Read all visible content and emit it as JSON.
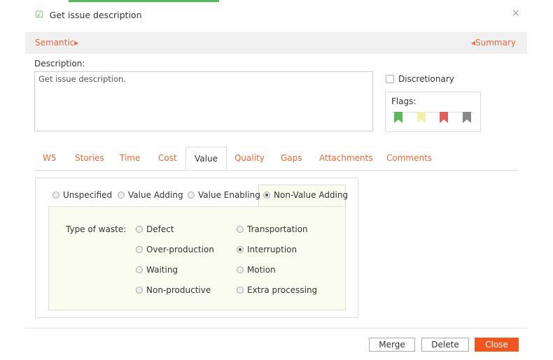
{
  "dialog": {
    "title": "Get issue description",
    "close_symbol": "×"
  },
  "semantic_bar": {
    "left_label": "Semantic",
    "left_arrow": "▸",
    "right_label": "Summary",
    "right_arrow": "◂"
  },
  "description": {
    "label": "Description:",
    "value": "Get issue description."
  },
  "discretionary": {
    "label": "Discretionary",
    "checked": false
  },
  "flags": {
    "label": "Flags:",
    "colors": [
      "#5cb85c",
      "#f3eeb0",
      "#e0605a",
      "#888888"
    ]
  },
  "tabs": [
    "W5",
    "Stories",
    "Time",
    "Cost",
    "Value",
    "Quality",
    "Gaps",
    "Attachments",
    "Comments"
  ],
  "active_tab": "Value",
  "value_options": [
    "Unspecified",
    "Value Adding",
    "Value Enabling",
    "Non-Value Adding"
  ],
  "selected_value": "Non-Value Adding",
  "waste": {
    "label": "Type of waste:",
    "options": [
      "Defect",
      "Transportation",
      "Over-production",
      "Interruption",
      "Waiting",
      "Motion",
      "Non-productive",
      "Extra processing"
    ],
    "selected": "Interruption"
  },
  "buttons": {
    "merge": "Merge",
    "delete": "Delete",
    "close": "Close"
  },
  "colors": {
    "accent": "#e8683a",
    "primary_button": "#f0561e",
    "check_green": "#5cb85c"
  }
}
